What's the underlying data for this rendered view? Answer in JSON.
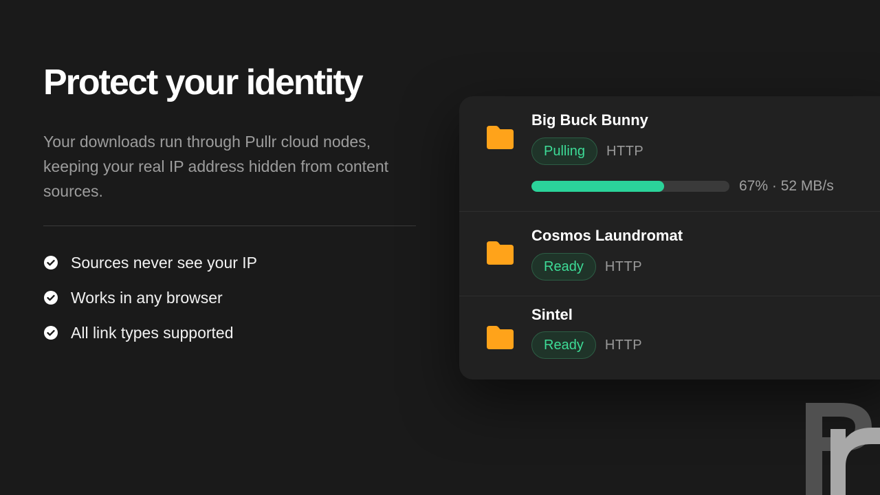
{
  "hero": {
    "title": "Protect your identity",
    "subtitle": "Your downloads run through Pullr cloud nodes, keeping your real IP address hidden from content sources."
  },
  "features": [
    {
      "icon": "check-circle-icon",
      "text": "Sources never see your IP"
    },
    {
      "icon": "check-circle-icon",
      "text": "Works in any browser"
    },
    {
      "icon": "check-circle-icon",
      "text": "All link types supported"
    }
  ],
  "downloads": [
    {
      "icon": "folder-icon",
      "name": "Big Buck Bunny",
      "status": "Pulling",
      "protocol": "HTTP",
      "progress_percent": 67,
      "progress_text": "67% · 52 MB/s"
    },
    {
      "icon": "folder-icon",
      "name": "Cosmos Laundromat",
      "status": "Ready",
      "protocol": "HTTP"
    },
    {
      "icon": "folder-icon",
      "name": "Sintel",
      "status": "Ready",
      "protocol": "HTTP"
    }
  ],
  "colors": {
    "background": "#1a1a1a",
    "card": "#212121",
    "accent_green": "#2bd39a",
    "folder_orange": "#ffa31a",
    "muted_text": "#9d9d9d"
  },
  "watermark": {
    "icon": "pullr-logo-icon"
  }
}
